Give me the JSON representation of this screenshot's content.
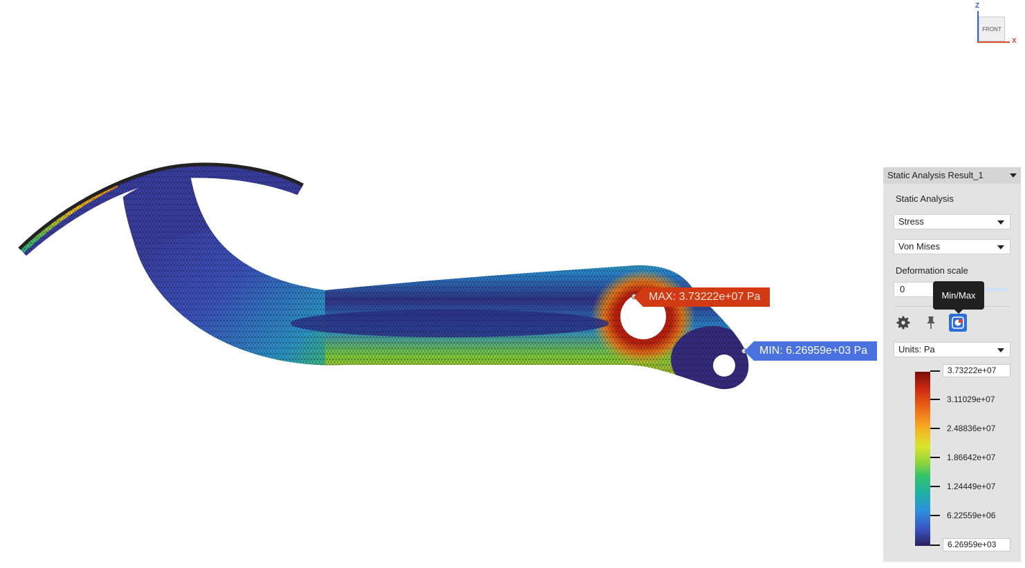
{
  "view_cube": {
    "face_label": "FRONT",
    "axis_z": "Z",
    "axis_x": "X"
  },
  "annotations": {
    "max_label": "MAX: 3.73222e+07 Pa",
    "min_label": "MIN: 6.26959e+03 Pa"
  },
  "panel": {
    "title": "Static Analysis Result_1",
    "section_label": "Static Analysis",
    "result_type": "Stress",
    "component": "Von Mises",
    "deformation_label": "Deformation scale",
    "deformation_value": "0",
    "deformation_level": 0,
    "tooltip": "Min/Max",
    "units": "Units: Pa"
  },
  "legend": {
    "max": "3.73222e+07",
    "ticks": [
      "3.11029e+07",
      "2.48836e+07",
      "1.86642e+07",
      "1.24449e+07",
      "6.22559e+06"
    ],
    "min": "6.26959e+03"
  },
  "colors": {
    "max_tag": "#d13a12",
    "min_tag": "#4a72de",
    "accent": "#2e6ed6",
    "axis_z": "#2f64d8",
    "axis_x": "#e04b2e"
  },
  "icons": [
    "gear-icon",
    "pin-icon",
    "minmax-icon",
    "dropdown-arrow-icon"
  ]
}
